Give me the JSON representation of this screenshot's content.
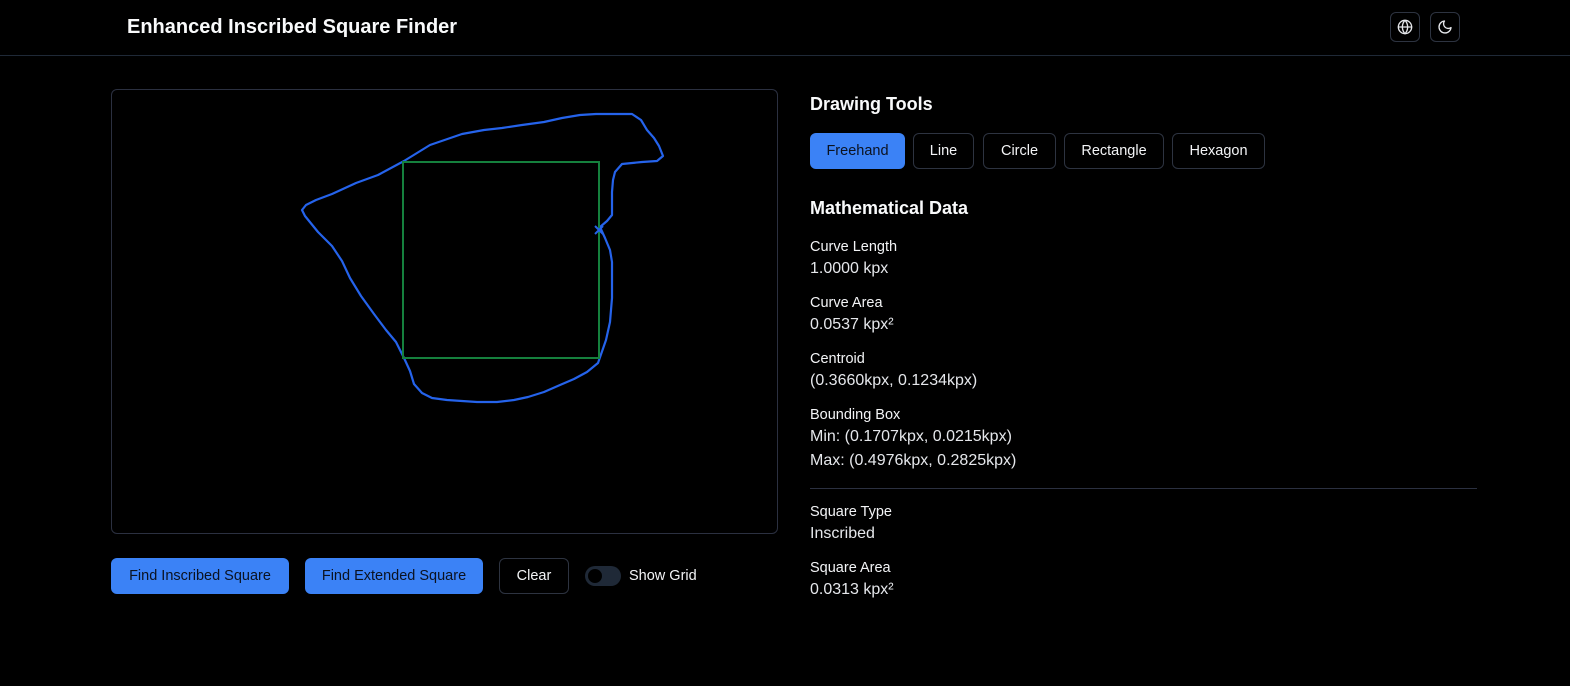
{
  "header": {
    "title": "Enhanced Inscribed Square Finder",
    "language_icon": "globe-icon",
    "theme_icon": "moon-icon"
  },
  "canvas": {
    "curve_color": "#2563eb",
    "square_color": "#15803d"
  },
  "actions": {
    "find_inscribed": "Find Inscribed Square",
    "find_extended": "Find Extended Square",
    "clear": "Clear",
    "show_grid": "Show Grid",
    "show_grid_on": false
  },
  "tools": {
    "title": "Drawing Tools",
    "items": [
      "Freehand",
      "Line",
      "Circle",
      "Rectangle",
      "Hexagon"
    ],
    "active": "Freehand"
  },
  "math": {
    "title": "Mathematical Data",
    "curve_length_label": "Curve Length",
    "curve_length": "1.0000 kpx",
    "curve_area_label": "Curve Area",
    "curve_area": "0.0537 kpx²",
    "centroid_label": "Centroid",
    "centroid": "(0.3660kpx, 0.1234kpx)",
    "bbox_label": "Bounding Box",
    "bbox_min": "Min: (0.1707kpx, 0.0215kpx)",
    "bbox_max": "Max: (0.4976kpx, 0.2825kpx)",
    "square_type_label": "Square Type",
    "square_type": "Inscribed",
    "square_area_label": "Square Area",
    "square_area": "0.0313 kpx²"
  },
  "colors": {
    "accent": "#3b82f6",
    "background": "#000000",
    "border": "#2d3340"
  }
}
